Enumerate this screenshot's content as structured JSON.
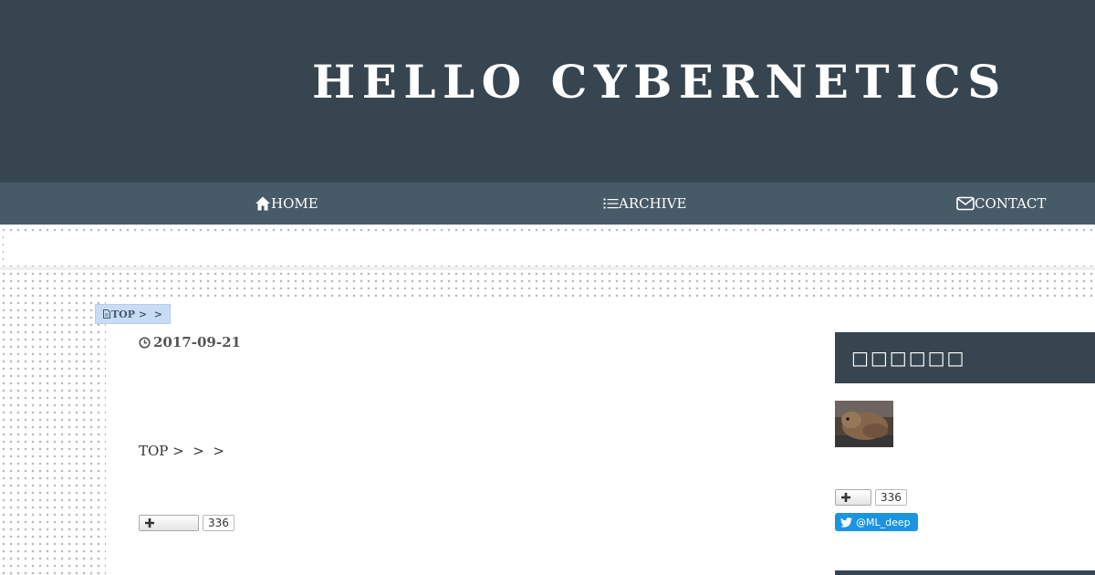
{
  "site": {
    "title": "HELLO CYBERNETICS"
  },
  "nav": {
    "items": [
      {
        "label": "HOME",
        "icon": "home-icon"
      },
      {
        "label": "ARCHIVE",
        "icon": "list-icon"
      },
      {
        "label": "CONTACT",
        "icon": "mail-icon"
      }
    ]
  },
  "breadcrumb": {
    "label": "TOP >  >",
    "icon": "document-icon"
  },
  "article": {
    "date": "2017-09-21",
    "breadcrumb_text": "TOP >  >  >",
    "bookmark_count": "336"
  },
  "sidebar": {
    "heading": "□□□□□□",
    "bookmark_count": "336",
    "twitter_label": "@ML_deep"
  },
  "colors": {
    "header_bg": "#36454f",
    "nav_bg": "#475a67",
    "breadcrumb_bg": "#c9dcf6",
    "twitter_blue": "#1b95e0"
  }
}
